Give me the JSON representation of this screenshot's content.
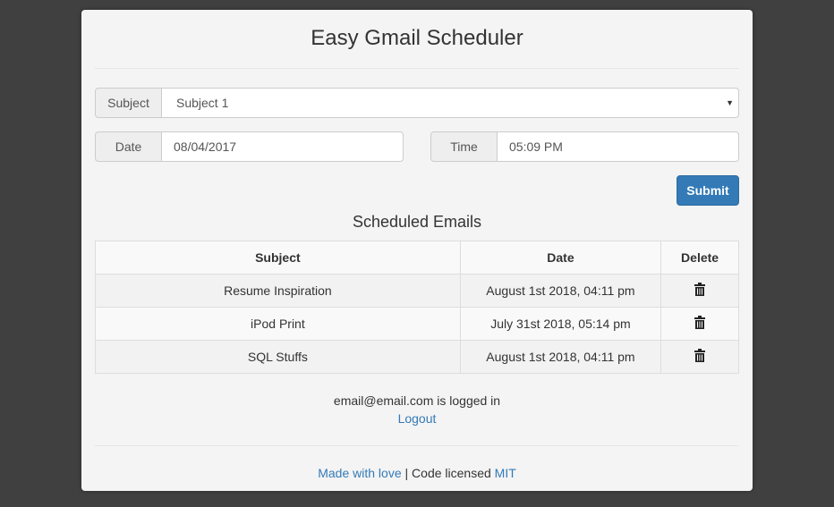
{
  "header": {
    "title": "Easy Gmail Scheduler"
  },
  "form": {
    "subject_label": "Subject",
    "subject_value": "Subject 1",
    "date_label": "Date",
    "date_value": "08/04/2017",
    "time_label": "Time",
    "time_value": "05:09 PM",
    "submit_label": "Submit"
  },
  "scheduled": {
    "title": "Scheduled Emails",
    "columns": [
      "Subject",
      "Date",
      "Delete"
    ],
    "rows": [
      {
        "subject": "Resume Inspiration",
        "date": "August 1st 2018, 04:11 pm",
        "delete_icon": "trash-icon"
      },
      {
        "subject": "iPod Print",
        "date": "July 31st 2018, 05:14 pm",
        "delete_icon": "trash-icon"
      },
      {
        "subject": "SQL Stuffs",
        "date": "August 1st 2018, 04:11 pm",
        "delete_icon": "trash-icon"
      }
    ]
  },
  "session": {
    "logged_in_text": "email@email.com is logged in",
    "logout_label": "Logout"
  },
  "footer": {
    "made_with_love": "Made with love",
    "separator": " | Code licensed ",
    "license": "MIT"
  },
  "colors": {
    "background": "#404040",
    "card": "#f4f4f4",
    "accent": "#337ab7"
  }
}
